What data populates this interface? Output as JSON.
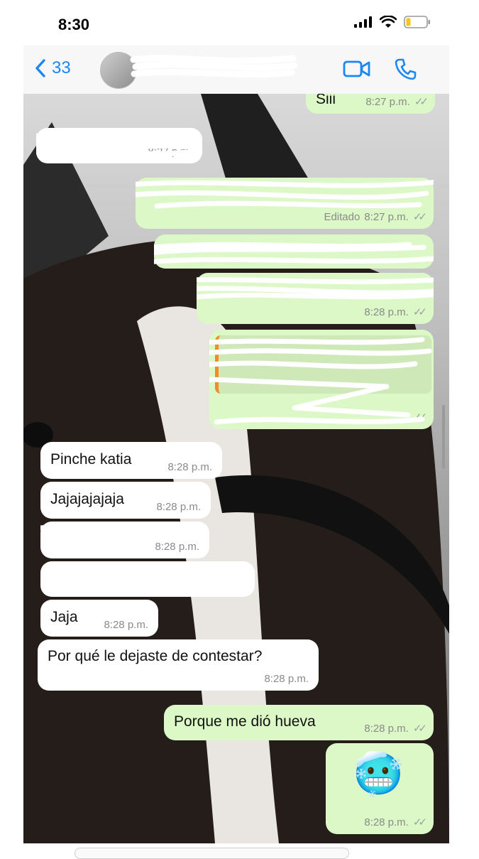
{
  "status_bar": {
    "time": "8:30"
  },
  "header": {
    "back_count": "33",
    "contact_name": ""
  },
  "icons": {
    "back": "chevron-left-icon",
    "video": "video-camera-icon",
    "call": "phone-icon",
    "signal": "cellular-signal-icon",
    "wifi": "wifi-icon",
    "battery": "battery-icon",
    "read": "double-check-icon"
  },
  "colors": {
    "accent": "#1b86f5",
    "outgoing_bubble": "#dcf8c6",
    "incoming_bubble": "#ffffff",
    "quote_bar": "#f28c28",
    "battery_low": "#f5c518"
  },
  "messages": [
    {
      "dir": "out",
      "text": "Siii",
      "time": "8:27 p.m.",
      "read": true
    },
    {
      "dir": "in",
      "text": "",
      "time": "8:27 p.m."
    },
    {
      "dir": "out",
      "text": "",
      "edited": "Editado",
      "time": "8:27 p.m.",
      "read": true
    },
    {
      "dir": "out",
      "text": "",
      "time": "",
      "read": false
    },
    {
      "dir": "out",
      "text": "",
      "time": "8:28 p.m.",
      "read": true
    },
    {
      "dir": "out",
      "text": "",
      "time": "",
      "read": true
    },
    {
      "dir": "in",
      "text": "Pinche katia",
      "time": "8:28 p.m."
    },
    {
      "dir": "in",
      "text": "Jajajajajaja",
      "time": "8:28 p.m."
    },
    {
      "dir": "in",
      "text": "",
      "time": "8:28 p.m."
    },
    {
      "dir": "in",
      "text": "",
      "time": ""
    },
    {
      "dir": "in",
      "text": "Jaja",
      "time": "8:28 p.m."
    },
    {
      "dir": "in",
      "text": "Por qué le dejaste de contestar?",
      "time": "8:28 p.m."
    },
    {
      "dir": "out",
      "text": "Porque me dió hueva",
      "time": "8:28 p.m.",
      "read": true
    },
    {
      "dir": "out",
      "emoji": "🥶",
      "time": "8:28 p.m.",
      "read": true
    }
  ]
}
